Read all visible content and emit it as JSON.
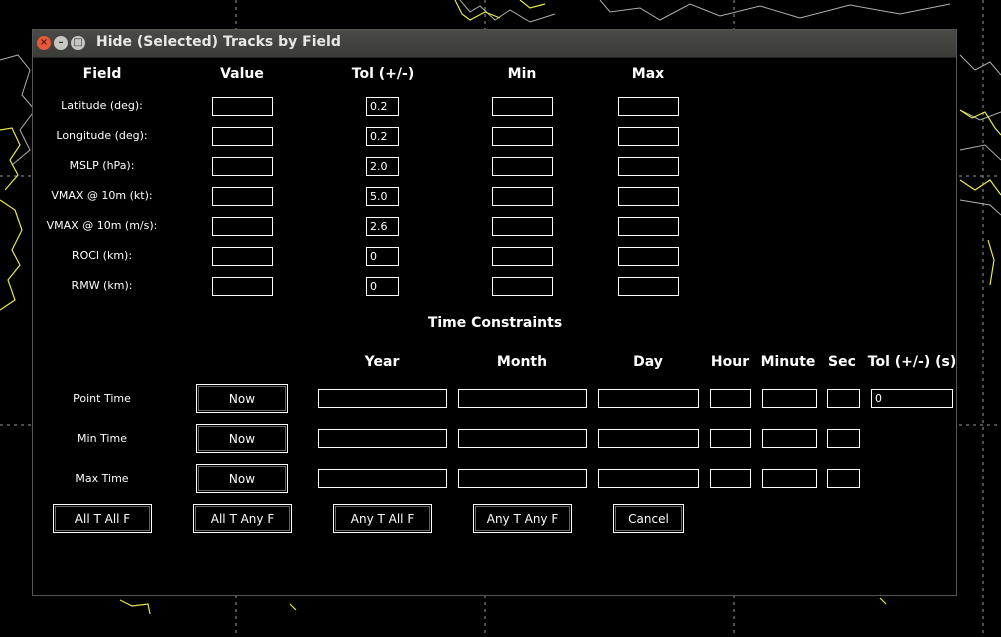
{
  "window": {
    "title": "Hide (Selected) Tracks by Field"
  },
  "field_table": {
    "headers": {
      "field": "Field",
      "value": "Value",
      "tol": "Tol (+/-)",
      "min": "Min",
      "max": "Max"
    },
    "rows": [
      {
        "label": "Latitude (deg):",
        "value": "",
        "tol": "0.2",
        "min": "",
        "max": ""
      },
      {
        "label": "Longitude (deg):",
        "value": "",
        "tol": "0.2",
        "min": "",
        "max": ""
      },
      {
        "label": "MSLP (hPa):",
        "value": "",
        "tol": "2.0",
        "min": "",
        "max": ""
      },
      {
        "label": "VMAX @ 10m (kt):",
        "value": "",
        "tol": "5.0",
        "min": "",
        "max": ""
      },
      {
        "label": "VMAX @ 10m (m/s):",
        "value": "",
        "tol": "2.6",
        "min": "",
        "max": ""
      },
      {
        "label": "ROCI (km):",
        "value": "",
        "tol": "0",
        "min": "",
        "max": ""
      },
      {
        "label": "RMW (km):",
        "value": "",
        "tol": "0",
        "min": "",
        "max": ""
      }
    ]
  },
  "time_constraints": {
    "title": "Time Constraints",
    "headers": {
      "year": "Year",
      "month": "Month",
      "day": "Day",
      "hour": "Hour",
      "minute": "Minute",
      "sec": "Sec",
      "tol": "Tol (+/-) (s)"
    },
    "rows": [
      {
        "label": "Point Time",
        "now_label": "Now",
        "tol": "0"
      },
      {
        "label": "Min Time",
        "now_label": "Now"
      },
      {
        "label": "Max Time",
        "now_label": "Now"
      }
    ]
  },
  "buttons": {
    "all_t_all_f": "All T All F",
    "all_t_any_f": "All T Any F",
    "any_t_all_f": "Any T All F",
    "any_t_any_f": "Any T Any F",
    "cancel": "Cancel"
  },
  "colors": {
    "background": "#000000",
    "coastline": "#e8e84a",
    "borders": "#b0b0b0",
    "grid": "#9a9a9a"
  }
}
